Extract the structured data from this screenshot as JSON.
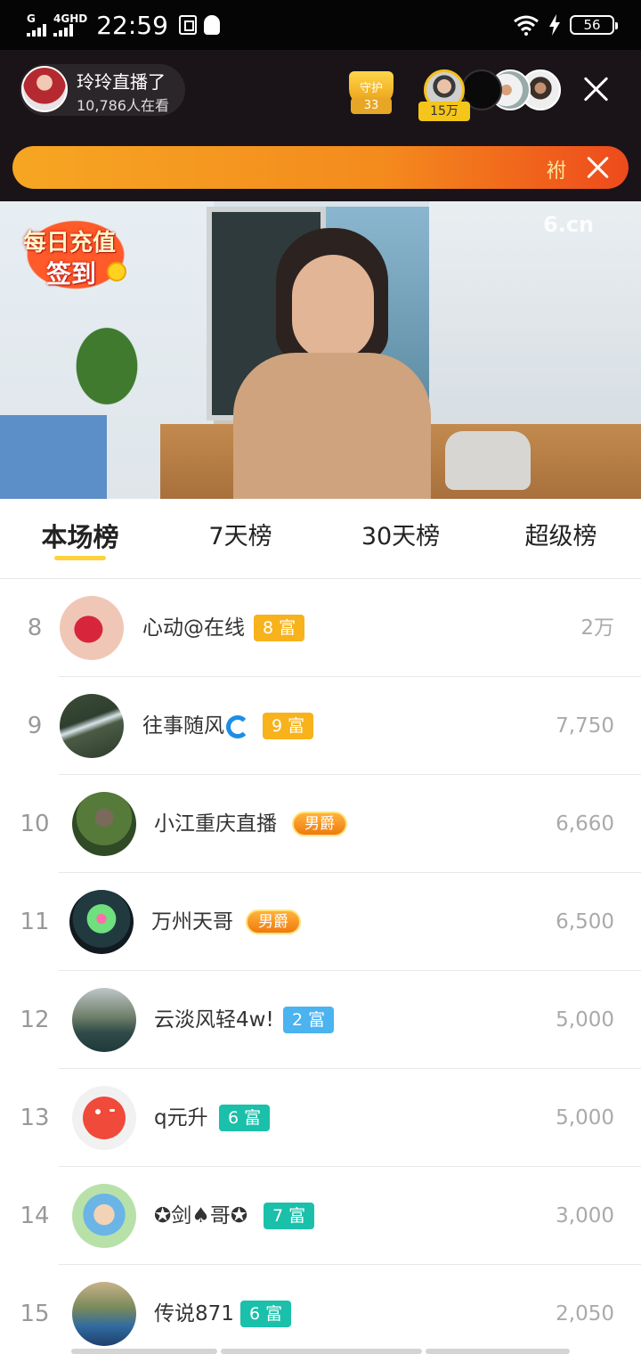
{
  "status_bar": {
    "network_g": "G",
    "network_4g": "4GHD",
    "time": "22:59",
    "battery": "56"
  },
  "live_header": {
    "anchor_name": "玲玲直播了",
    "viewers": "10,786人在看",
    "guard_label": "守护",
    "guard_count": "33",
    "top_viewer_badge": "15万"
  },
  "banner": {
    "tag": "袝"
  },
  "video": {
    "watermark": "6.cn",
    "checkin_line1": "每日充值",
    "checkin_line2": "签到"
  },
  "tabs": [
    "本场榜",
    "7天榜",
    "30天榜",
    "超级榜"
  ],
  "active_tab": 0,
  "leaderboard": [
    {
      "rank": "8",
      "name": "心动@在线",
      "badge": "8 富",
      "badge_color": "#f7b21c",
      "score": "2万"
    },
    {
      "rank": "9",
      "name": "往事随风",
      "badge": "9 富",
      "badge_color": "#f7b21c",
      "score": "7,750"
    },
    {
      "rank": "10",
      "name": "小江重庆直播",
      "badge": "男爵",
      "badge_color": "#ef7a10",
      "score": "6,660"
    },
    {
      "rank": "11",
      "name": "万州天哥",
      "badge": "男爵",
      "badge_color": "#ef7a10",
      "score": "6,500"
    },
    {
      "rank": "12",
      "name": "云淡风轻4w!",
      "badge": "2 富",
      "badge_color": "#4ab3f0",
      "score": "5,000"
    },
    {
      "rank": "13",
      "name": "q元升",
      "badge": "6 富",
      "badge_color": "#1ac0aa",
      "score": "5,000"
    },
    {
      "rank": "14",
      "name": "✪剑♠哥✪",
      "badge": "7 富",
      "badge_color": "#1ac0aa",
      "score": "3,000"
    },
    {
      "rank": "15",
      "name": "传说871",
      "badge": "6 富",
      "badge_color": "#1ac0aa",
      "score": "2,050"
    }
  ],
  "colors": {
    "accent_tab": "#ffd23c",
    "banner_start": "#f6a623",
    "banner_end": "#ee4a1c"
  }
}
